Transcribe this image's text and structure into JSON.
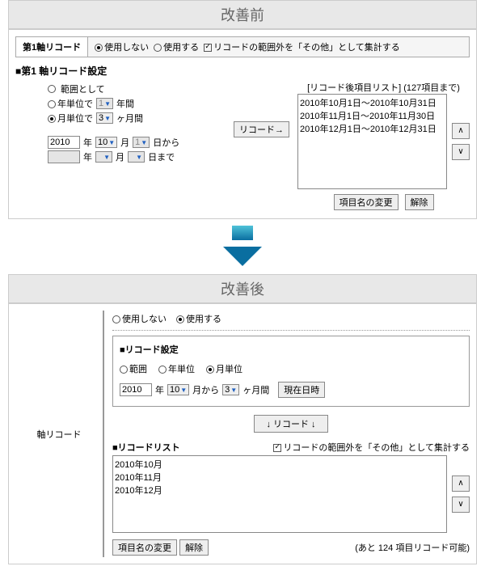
{
  "before": {
    "header": "改善前",
    "tab": "第1軸リコード",
    "opt_none": "使用しない",
    "opt_use": "使用する",
    "opt_aggregate": "リコードの範囲外を「その他」として集計する",
    "section_title": "■第1 軸リコード設定",
    "r_range": "範囲として",
    "r_year": "年単位で",
    "r_month": "月単位で",
    "year_sel": "1",
    "year_unit": "年間",
    "month_sel": "3",
    "month_unit": "ヶ月間",
    "btn_recode": "リコード→",
    "start_year": "2010",
    "lbl_y": "年",
    "start_m": "10",
    "lbl_m": "月",
    "start_d": "1",
    "lbl_d_from": "日から",
    "lbl_d_to": "日まで",
    "list_header": "[リコード後項目リスト] (127項目まで)",
    "list": [
      "2010年10月1日～2010年10月31日",
      "2010年11月1日～2010年11月30日",
      "2010年12月1日～2010年12月31日"
    ],
    "btn_rename": "項目名の変更",
    "btn_clear": "解除",
    "btn_up": "∧",
    "btn_down": "∨"
  },
  "after": {
    "header": "改善後",
    "side_label": "軸リコード",
    "opt_none": "使用しない",
    "opt_use": "使用する",
    "fs_title": "■リコード設定",
    "r_range": "範囲",
    "r_year": "年単位",
    "r_month": "月単位",
    "year_val": "2010",
    "lbl_y": "年",
    "m_val": "10",
    "lbl_m_from": "月から",
    "dur_val": "3",
    "lbl_dur": "ヶ月間",
    "btn_now": "現在日時",
    "btn_recode": "↓ リコード ↓",
    "list_title": "■リコードリスト",
    "chk_aggregate": "リコードの範囲外を「その他」として集計する",
    "list": [
      "2010年10月",
      "2010年11月",
      "2010年12月"
    ],
    "btn_rename": "項目名の変更",
    "btn_clear": "解除",
    "remaining": "(あと 124 項目リコード可能)",
    "btn_up": "∧",
    "btn_down": "∨"
  }
}
